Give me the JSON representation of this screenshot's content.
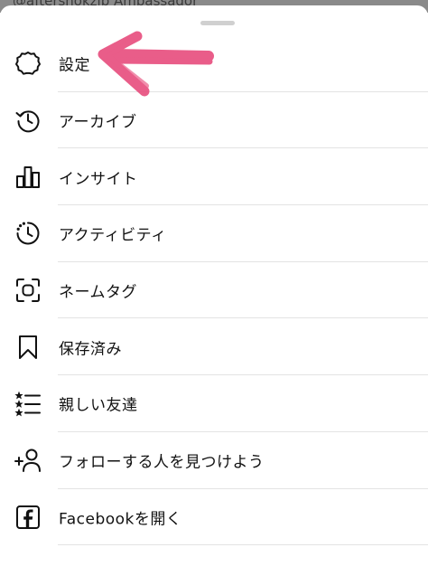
{
  "backdrop": {
    "text": "@aftershokzjp Ambassador"
  },
  "menu": {
    "items": [
      {
        "label": "設定",
        "icon": "gear-icon"
      },
      {
        "label": "アーカイブ",
        "icon": "archive-history-icon"
      },
      {
        "label": "インサイト",
        "icon": "insights-bar-chart-icon"
      },
      {
        "label": "アクティビティ",
        "icon": "activity-clock-icon"
      },
      {
        "label": "ネームタグ",
        "icon": "nametag-scan-icon"
      },
      {
        "label": "保存済み",
        "icon": "bookmark-icon"
      },
      {
        "label": "親しい友達",
        "icon": "close-friends-list-icon"
      },
      {
        "label": "フォローする人を見つけよう",
        "icon": "add-person-icon"
      },
      {
        "label": "Facebookを開く",
        "icon": "facebook-icon"
      }
    ]
  },
  "annotation": {
    "color": "#e8507f",
    "icon": "pink-arrow-annotation"
  }
}
